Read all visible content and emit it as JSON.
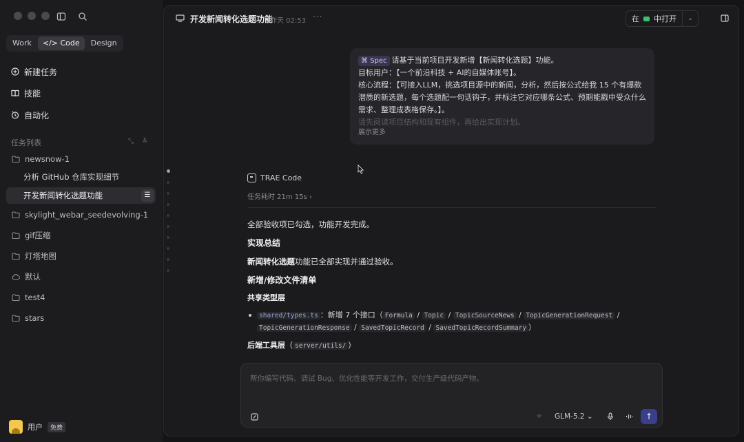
{
  "sidebar": {
    "modes": [
      {
        "label": "Work",
        "active": false
      },
      {
        "label": "</> Code",
        "active": true
      },
      {
        "label": "Design",
        "active": false
      }
    ],
    "nav": [
      {
        "label": "新建任务",
        "icon": "plus-circle-icon"
      },
      {
        "label": "技能",
        "icon": "book-icon"
      },
      {
        "label": "自动化",
        "icon": "clock-icon"
      }
    ],
    "section_title": "任务列表",
    "tasks": [
      {
        "label": "newsnow-1",
        "icon": "folder-icon",
        "kind": "folder"
      },
      {
        "label": "分析 GitHub 仓库实现细节",
        "kind": "sub"
      },
      {
        "label": "开发新闻转化选题功能",
        "kind": "sub",
        "active": true
      },
      {
        "label": "skylight_webar_seedevolving-1",
        "icon": "folder-icon",
        "kind": "folder"
      },
      {
        "label": "gif压缩",
        "icon": "folder-icon",
        "kind": "folder"
      },
      {
        "label": "灯塔地图",
        "icon": "folder-icon",
        "kind": "folder"
      },
      {
        "label": "默认",
        "icon": "cloud-icon",
        "kind": "folder"
      },
      {
        "label": "test4",
        "icon": "folder-icon",
        "kind": "folder"
      },
      {
        "label": "stars",
        "icon": "folder-icon",
        "kind": "folder"
      }
    ],
    "user": {
      "name": "用户",
      "badge": "免费"
    }
  },
  "header": {
    "title": "开发新闻转化选题功能",
    "time": "昨天 02:53",
    "more": "···",
    "open_prefix": "在",
    "open_label": "中打开"
  },
  "message": {
    "tag": "Spec",
    "lines": [
      "请基于当前项目开发新增【新闻转化选题】功能。",
      "目标用户：【一个前沿科技 + AI的自媒体账号】。",
      "核心流程：【可接入LLM，挑选项目源中的新闻，分析，然后按公式给我 15 个有爆款",
      "潜质的新选题，每个选题配一句话钩子，并标注它对应哪条公式、预期能戳中受众什么",
      "需求、整理成表格保存。】。",
      "请先阅读项目结构和现有组件，再给出实现计划。"
    ],
    "show_more": "展示更多"
  },
  "answer": {
    "brand": "TRAE Code",
    "elapsed": "任务耗时 21m 15s ›",
    "intro": "全部验收项已勾选，功能开发完成。",
    "h1": "实现总结",
    "p1_bold": "新闻转化选题",
    "p1_rest": "功能已全部实现并通过验收。",
    "h2": "新增/修改文件清单",
    "h3": "共享类型层",
    "types_file": "shared/types.ts",
    "types_text": "：新增 7 个接口（",
    "interfaces": [
      "Formula",
      "Topic",
      "TopicSourceNews",
      "TopicGenerationRequest",
      "TopicGenerationResponse",
      "SavedTopicRecord",
      "SavedTopicRecordSummary"
    ],
    "close_paren": "）",
    "h4": "后端工具层",
    "h4_code": "server/utils/",
    "open_paren": "（",
    "close_paren2": "）"
  },
  "composer": {
    "placeholder": "帮你编写代码、调试 Bug、优化性能等开发工作，交付生产级代码产物。",
    "model": "GLM-5.2 ⌄",
    "send": "↑"
  }
}
